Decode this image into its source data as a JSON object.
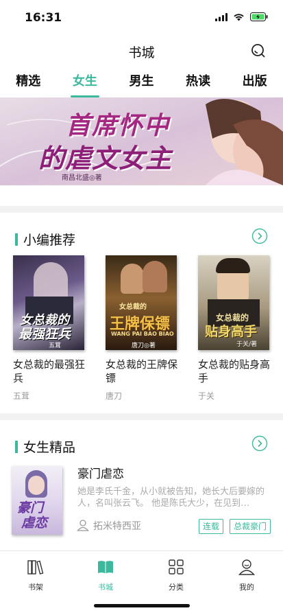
{
  "status": {
    "time": "16:31"
  },
  "nav": {
    "title": "书城"
  },
  "tabs": [
    {
      "label": "精选",
      "active": false
    },
    {
      "label": "女生",
      "active": true
    },
    {
      "label": "男生",
      "active": false
    },
    {
      "label": "热读",
      "active": false
    },
    {
      "label": "出版",
      "active": false
    }
  ],
  "banner": {
    "title_line1": "首席怀中",
    "title_line2": "的虐文女主",
    "author_stamp": "南昌北盛◎著"
  },
  "editor_picks": {
    "title": "小编推荐",
    "books": [
      {
        "title": "女总裁的最强狂兵",
        "author": "五茸",
        "cover_text_1": "女总裁的",
        "cover_text_2": "最强狂兵",
        "cover_author": "五茸"
      },
      {
        "title": "女总裁的王牌保镖",
        "author": "唐刀",
        "cover_text_1": "女总裁的",
        "cover_text_2": "王牌保镖",
        "cover_sub": "WANG PAI BAO BIAO",
        "cover_author": "唐刀◎著"
      },
      {
        "title": "女总裁的贴身高手",
        "author": "于关",
        "cover_text_1": "女总裁的",
        "cover_text_2": "贴身高手",
        "cover_author": "于关/著"
      }
    ]
  },
  "female_picks": {
    "title": "女生精品",
    "featured": {
      "title": "豪门虐恋",
      "description": "她是李氏千金，从小就被告知，她长大后要嫁的人，名叫张云飞。        他是陈氏大少，在见到…",
      "author": "拓米特西亚",
      "cover_text_1": "豪门",
      "cover_text_2": "虐恋",
      "tags": [
        "连载",
        "总裁豪门"
      ]
    }
  },
  "tabbar": [
    {
      "label": "书架",
      "icon": "bookshelf-icon",
      "active": false
    },
    {
      "label": "书城",
      "icon": "book-icon",
      "active": true
    },
    {
      "label": "分类",
      "icon": "grid-icon",
      "active": false
    },
    {
      "label": "我的",
      "icon": "profile-icon",
      "active": false
    }
  ],
  "colors": {
    "accent": "#3cb89c"
  }
}
